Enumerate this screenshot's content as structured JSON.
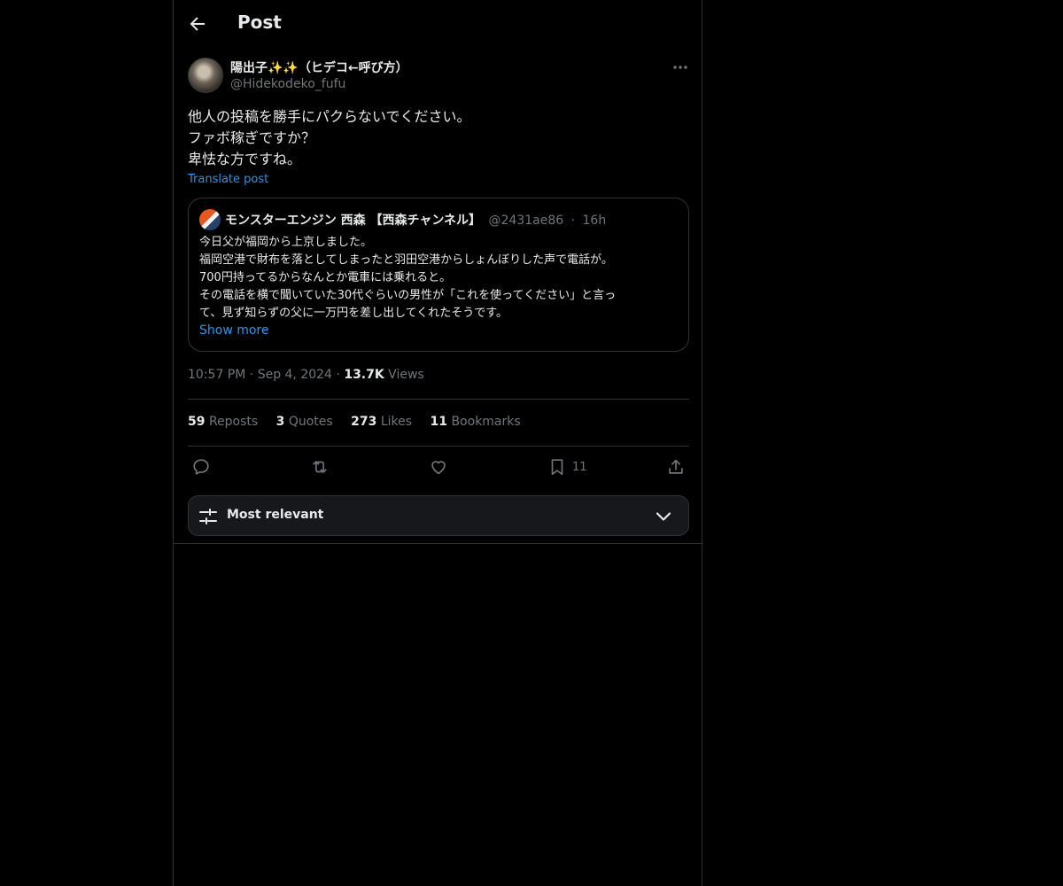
{
  "header": {
    "title": "Post"
  },
  "post": {
    "author_name": "陽出子✨✨（ヒデコ←呼び方）",
    "author_handle": "@Hidekodeko_fufu",
    "text_lines": [
      "他人の投稿を勝手にパクらないでください。",
      "ファボ稼ぎですか？",
      "卑怯な方ですね。"
    ],
    "translate_label": "Translate post",
    "time": "10:57 PM",
    "date": "Sep 4, 2024",
    "views_count": "13.7K",
    "views_label": "Views"
  },
  "quote": {
    "author_name": "モンスターエンジン 西森 【西森チャンネル】",
    "author_handle": "@2431ae86",
    "age": "16h",
    "text_lines": [
      "今日父が福岡から上京しました。",
      "福岡空港で財布を落としてしまったと羽田空港からしょんぼりした声で電話が。",
      "700円持ってるからなんとか電車には乗れると。",
      "その電話を横で聞いていた30代ぐらいの男性が「これを使ってください」と言っ",
      "て、見ず知らずの父に一万円を差し出してくれたそうです。"
    ],
    "show_more_label": "Show more"
  },
  "stats": {
    "reposts_count": "59",
    "reposts_label": "Reposts",
    "quotes_count": "3",
    "quotes_label": "Quotes",
    "likes_count": "273",
    "likes_label": "Likes",
    "bookmarks_count": "11",
    "bookmarks_label": "Bookmarks"
  },
  "actions": {
    "bookmark_count": "11"
  },
  "sort": {
    "label": "Most relevant"
  },
  "colors": {
    "background": "#000000",
    "text": "#e7e9ea",
    "muted": "#71767b",
    "accent": "#1d9bf0",
    "border": "#2f3336"
  },
  "icons": [
    "back-arrow-icon",
    "more-icon",
    "reply-icon",
    "repost-icon",
    "like-icon",
    "bookmark-icon",
    "share-icon",
    "sliders-icon",
    "chevron-down-icon"
  ]
}
